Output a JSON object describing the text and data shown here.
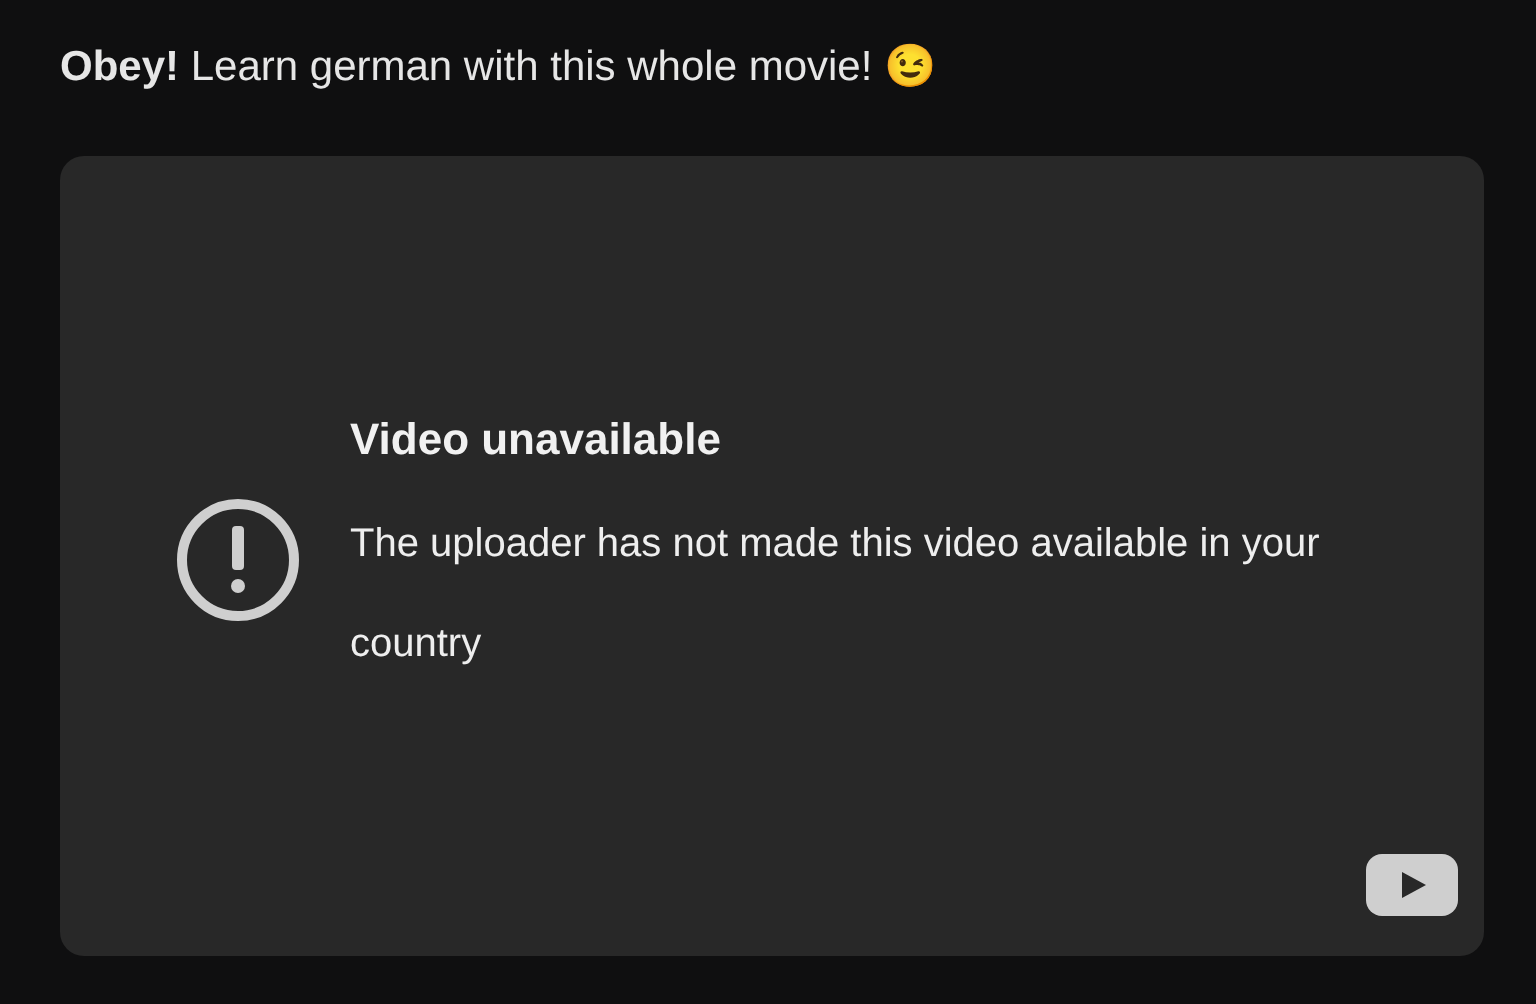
{
  "post": {
    "title": "**Obey!** Learn german with this whole movie! 😉"
  },
  "video": {
    "kind": "unavailable",
    "heading": "Video unavailable",
    "message": "The uploader has not made this video available in your country"
  }
}
